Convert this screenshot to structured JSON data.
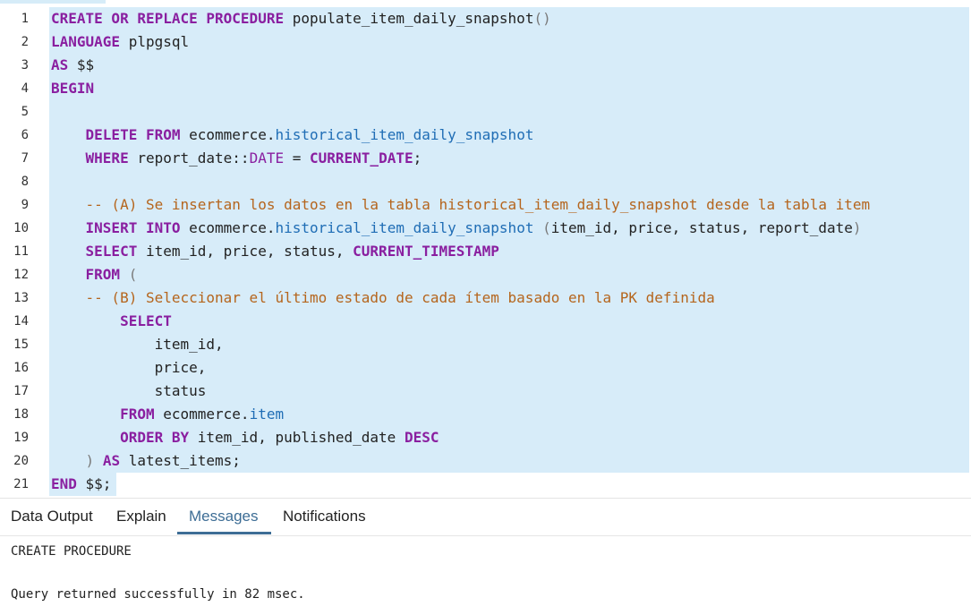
{
  "editor": {
    "lines": [
      {
        "num": "1",
        "tokens": [
          [
            "kw",
            "CREATE OR REPLACE PROCEDURE"
          ],
          [
            "",
            "populate_item_daily_snapshot"
          ],
          [
            "pn",
            "()"
          ]
        ]
      },
      {
        "num": "2",
        "tokens": [
          [
            "kw",
            "LANGUAGE"
          ],
          [
            "",
            "plpgsql"
          ]
        ]
      },
      {
        "num": "3",
        "tokens": [
          [
            "kw",
            "AS"
          ],
          [
            "",
            "$$"
          ]
        ]
      },
      {
        "num": "4",
        "tokens": [
          [
            "kw",
            "BEGIN"
          ]
        ]
      },
      {
        "num": "5",
        "tokens": []
      },
      {
        "num": "6",
        "tokens": [
          [
            "",
            "    "
          ],
          [
            "kw",
            "DELETE FROM"
          ],
          [
            "",
            " ecommerce."
          ],
          [
            "id",
            "historical_item_daily_snapshot"
          ]
        ]
      },
      {
        "num": "7",
        "tokens": [
          [
            "",
            "    "
          ],
          [
            "kw",
            "WHERE"
          ],
          [
            "",
            " report_date::"
          ],
          [
            "ty",
            "DATE"
          ],
          [
            "",
            " = "
          ],
          [
            "kw",
            "CURRENT_DATE"
          ],
          [
            "",
            ";"
          ]
        ]
      },
      {
        "num": "8",
        "tokens": []
      },
      {
        "num": "9",
        "tokens": [
          [
            "",
            "    "
          ],
          [
            "cm",
            "-- (A) Se insertan los datos en la tabla historical_item_daily_snapshot desde la tabla item"
          ]
        ]
      },
      {
        "num": "10",
        "tokens": [
          [
            "",
            "    "
          ],
          [
            "kw",
            "INSERT INTO"
          ],
          [
            "",
            " ecommerce."
          ],
          [
            "id",
            "historical_item_daily_snapshot"
          ],
          [
            "pn",
            " ("
          ],
          [
            "",
            "item_id, price, status, report_date"
          ],
          [
            "pn",
            ")"
          ]
        ]
      },
      {
        "num": "11",
        "tokens": [
          [
            "",
            "    "
          ],
          [
            "kw",
            "SELECT"
          ],
          [
            "",
            " item_id, price, status, "
          ],
          [
            "kw",
            "CURRENT_TIMESTAMP"
          ]
        ]
      },
      {
        "num": "12",
        "tokens": [
          [
            "",
            "    "
          ],
          [
            "kw",
            "FROM"
          ],
          [
            "pn",
            " ("
          ]
        ]
      },
      {
        "num": "13",
        "tokens": [
          [
            "",
            "    "
          ],
          [
            "cm",
            "-- (B) Seleccionar el último estado de cada ítem basado en la PK definida"
          ]
        ]
      },
      {
        "num": "14",
        "tokens": [
          [
            "",
            "        "
          ],
          [
            "kw",
            "SELECT"
          ]
        ]
      },
      {
        "num": "15",
        "tokens": [
          [
            "",
            "            item_id,"
          ]
        ]
      },
      {
        "num": "16",
        "tokens": [
          [
            "",
            "            price,"
          ]
        ]
      },
      {
        "num": "17",
        "tokens": [
          [
            "",
            "            status"
          ]
        ]
      },
      {
        "num": "18",
        "tokens": [
          [
            "",
            "        "
          ],
          [
            "kw",
            "FROM"
          ],
          [
            "",
            " ecommerce."
          ],
          [
            "id",
            "item"
          ]
        ]
      },
      {
        "num": "19",
        "tokens": [
          [
            "",
            "        "
          ],
          [
            "kw",
            "ORDER BY"
          ],
          [
            "",
            " item_id, published_date "
          ],
          [
            "kw",
            "DESC"
          ]
        ]
      },
      {
        "num": "20",
        "tokens": [
          [
            "",
            "    "
          ],
          [
            "pn",
            ")"
          ],
          [
            "",
            " "
          ],
          [
            "kw",
            "AS"
          ],
          [
            "",
            " latest_items;"
          ]
        ]
      },
      {
        "num": "21",
        "tokens": [
          [
            "kw",
            "END"
          ],
          [
            "",
            " $$;"
          ]
        ]
      }
    ]
  },
  "tabs": [
    {
      "label": "Data Output",
      "active": false
    },
    {
      "label": "Explain",
      "active": false
    },
    {
      "label": "Messages",
      "active": true
    },
    {
      "label": "Notifications",
      "active": false
    }
  ],
  "messages": {
    "line1": "CREATE PROCEDURE",
    "line2": "Query returned successfully in 82 msec."
  },
  "colors": {
    "keyword": "#8a1fa0",
    "comment": "#b5651d",
    "identifier": "#1f6db5",
    "selection": "#d7ecf9",
    "active_tab": "#3d6d95"
  }
}
